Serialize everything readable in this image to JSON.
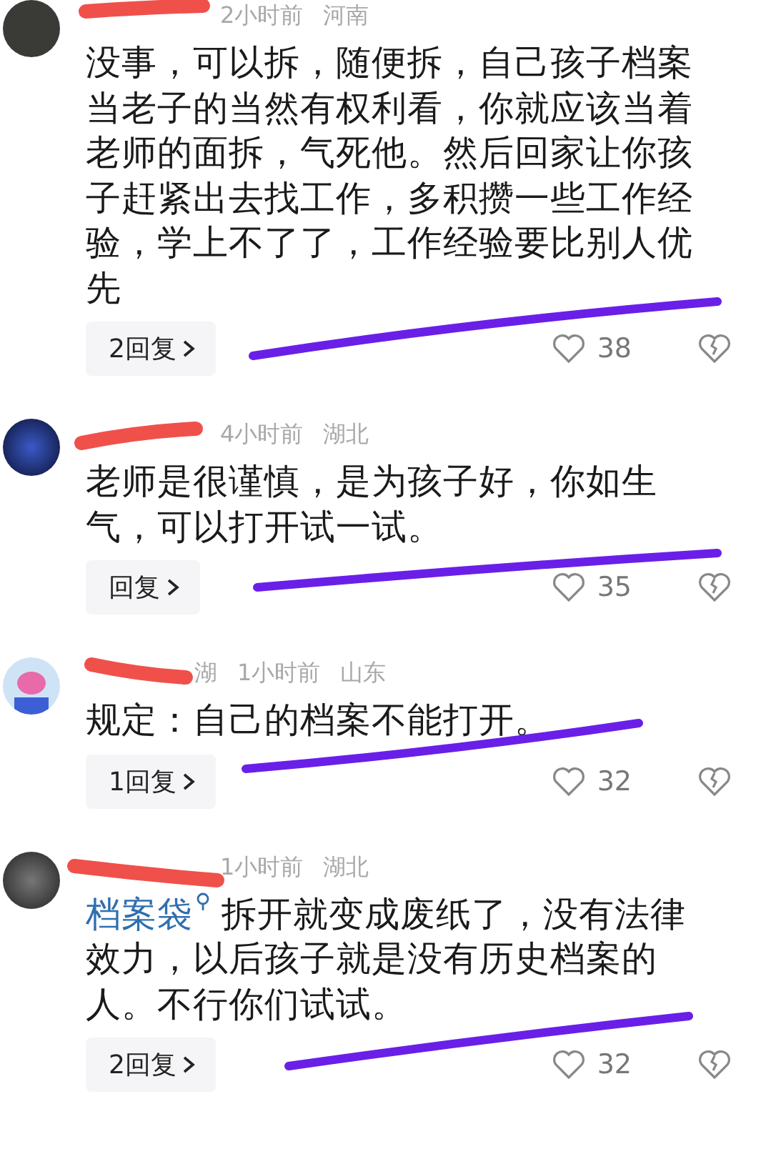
{
  "comments": [
    {
      "time": "2小时前",
      "location": "河南",
      "body": "没事，可以拆，随便拆，自己孩子档案当老子的当然有权利看，你就应该当着老师的面拆，气死他。然后回家让你孩子赶紧出去找工作，多积攒一些工作经验，学上不了了，工作经验要比别人优先",
      "replies": "2回复",
      "likes": "38"
    },
    {
      "time": "4小时前",
      "location": "湖北",
      "body": "老师是很谨慎，是为孩子好，你如生气，可以打开试一试。",
      "replies": "回复",
      "likes": "35"
    },
    {
      "name": "湖",
      "time": "1小时前",
      "location": "山东",
      "body": "规定：自己的档案不能打开。",
      "replies": "1回复",
      "likes": "32"
    },
    {
      "time": "1小时前",
      "location": "湖北",
      "link": "档案袋",
      "body": "拆开就变成废纸了，没有法律效力，以后孩子就是没有历史档案的人。不行你们试试。",
      "replies": "2回复",
      "likes": "32"
    }
  ]
}
